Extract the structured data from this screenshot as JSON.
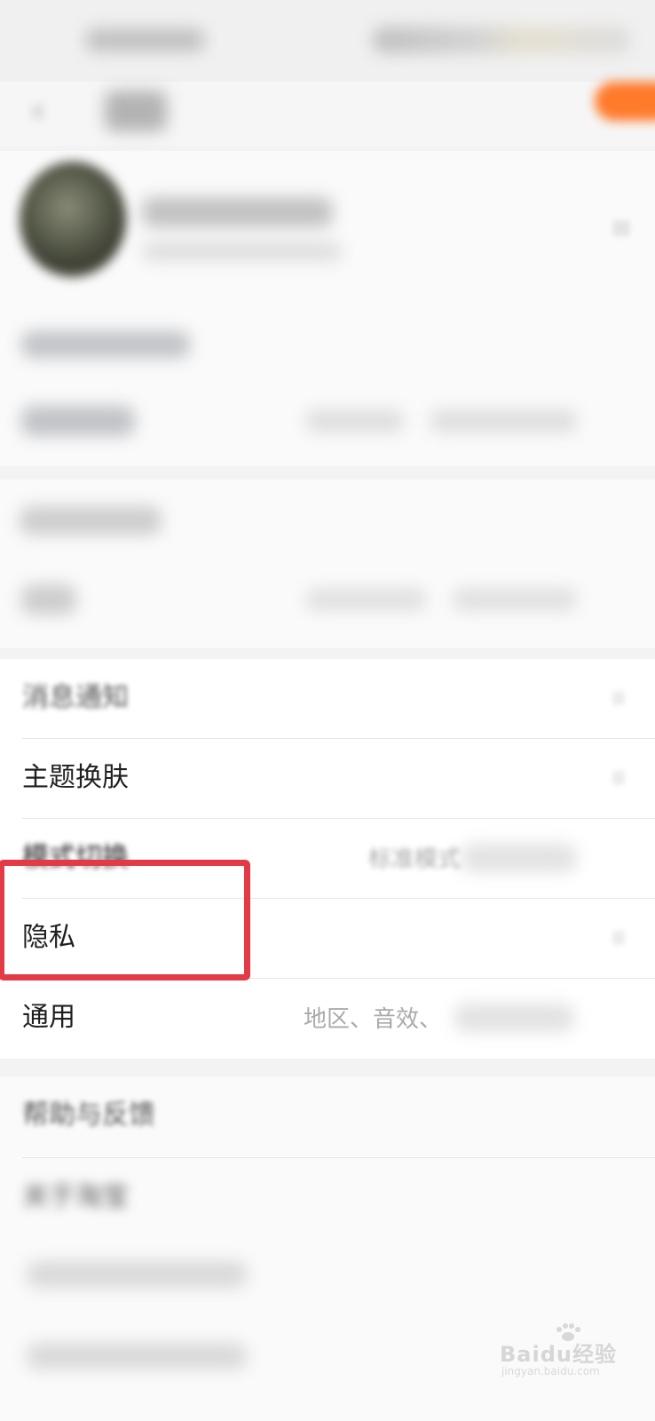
{
  "settings": {
    "items": [
      {
        "label": "消息通知",
        "value": ""
      },
      {
        "label": "主题换肤",
        "value": ""
      },
      {
        "label": "模式切换",
        "value": "标准模式"
      },
      {
        "label": "隐私",
        "value": ""
      },
      {
        "label": "通用",
        "value": "地区、音效、"
      }
    ]
  },
  "more": {
    "items": [
      {
        "label": "帮助与反馈"
      },
      {
        "label": "关于淘宝"
      }
    ]
  },
  "header": {
    "back_icon": "chevron-left-icon"
  },
  "watermark": {
    "brand": "Baidu经验",
    "url": "jingyan.baidu.com"
  },
  "colors": {
    "highlight": "#e33a45",
    "accent": "#ff7a2b"
  }
}
